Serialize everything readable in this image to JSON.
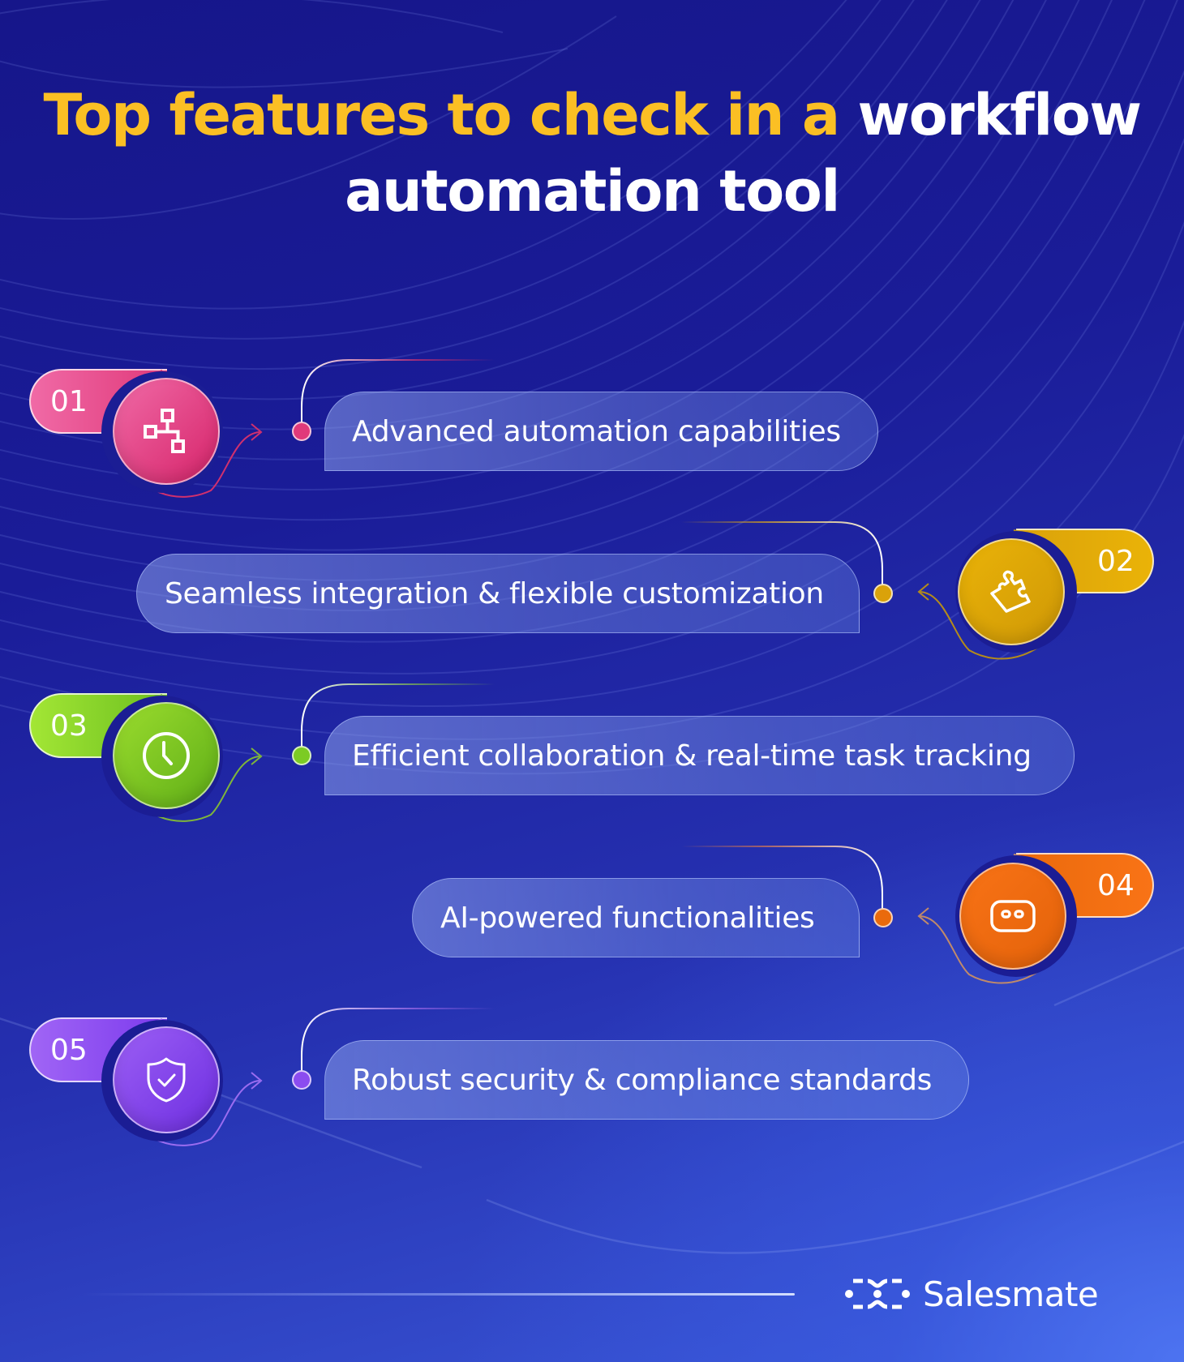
{
  "title": {
    "highlight": "Top features to check in a",
    "rest_line1": " workflow",
    "line2": "automation tool"
  },
  "colors": {
    "title_highlight": "#fbbf24",
    "background_dark": "#16168a",
    "background_light": "#4a6ae6"
  },
  "features": [
    {
      "number": "01",
      "label": "Advanced automation capabilities",
      "icon": "workflow-hierarchy-icon",
      "color": "#e0397a",
      "color_light": "#f06aa6"
    },
    {
      "number": "02",
      "label": "Seamless integration & flexible customization",
      "icon": "puzzle-piece-icon",
      "color": "#daa20a",
      "color_light": "#eab308"
    },
    {
      "number": "03",
      "label": "Efficient collaboration & real-time task tracking",
      "icon": "clock-icon",
      "color": "#6cbf1f",
      "color_light": "#a3e635"
    },
    {
      "number": "04",
      "label": "AI-powered functionalities",
      "icon": "robot-face-icon",
      "color": "#ea6a0c",
      "color_light": "#f97316"
    },
    {
      "number": "05",
      "label": "Robust security & compliance standards",
      "icon": "shield-check-icon",
      "color": "#7c3aed",
      "color_light": "#a065f5"
    }
  ],
  "footer": {
    "brand_name": "Salesmate",
    "brand_icon": "salesmate-logo-icon"
  }
}
